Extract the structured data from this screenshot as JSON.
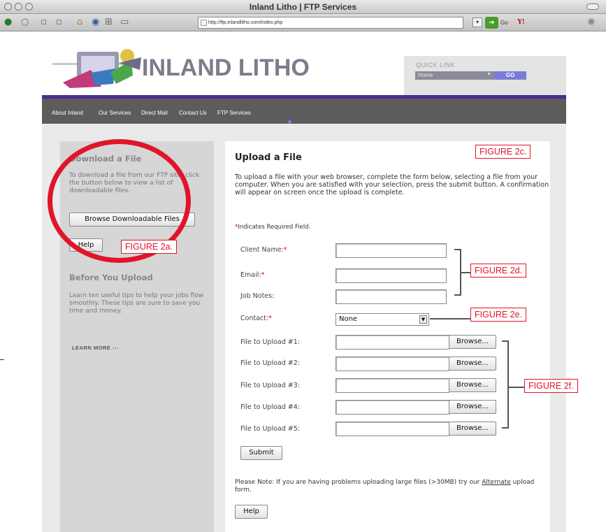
{
  "window": {
    "title": "Inland Litho | FTP Services"
  },
  "browser": {
    "url": "http://ftp.inlandlitho.com/index.php",
    "go_label": "Go",
    "yahoo_label": "Y!"
  },
  "site": {
    "logo_text": "INLAND LITHO",
    "quick_link": {
      "label": "QUICK LINK",
      "selected": "Home",
      "go": "GO"
    },
    "nav": [
      "About Inland",
      "Our Services",
      "Direct Mail",
      "Contact Us",
      "FTP Services"
    ]
  },
  "sidebar": {
    "download": {
      "heading": "Download a File",
      "text": "To download a file from our FTP site, click the button below to view a list of downloadable files.",
      "button": "Browse Downloadable Files",
      "help": "Help"
    },
    "before": {
      "heading": "Before You Upload",
      "text": "Learn ten useful tips to help your jobs flow smoothly. These tips are sure to save you time and money.",
      "learn_more": "LEARN MORE",
      "arrows": "›››"
    }
  },
  "main": {
    "heading": "Upload a File",
    "intro": "To upload a file with your web browser, complete the form below, selecting a file from your computer. When you are satisfied with your selection, press the submit button. A confirmation will appear on screen once the upload is complete.",
    "required_note": "Indicates Required Field.",
    "required_star": "*",
    "fields": {
      "client_name": "Client Name:",
      "email": "Email:",
      "job_notes": "Job Notes:",
      "contact": "Contact:"
    },
    "contact_selected": "None",
    "uploads": [
      "File to Upload #1:",
      "File to Upload #2:",
      "File to Upload #3:",
      "File to Upload #4:",
      "File to Upload #5:"
    ],
    "browse": "Browse...",
    "submit": "Submit",
    "note_prefix": "Please Note: If you are having problems uploading large files (>30MB) try our ",
    "note_link": "Alternate",
    "note_suffix": " upload form.",
    "help": "Help"
  },
  "annotations": {
    "fig_2a": "FIGURE 2a.",
    "fig_2c": "FIGURE 2c.",
    "fig_2d": "FIGURE 2d.",
    "fig_2e": "FIGURE 2e.",
    "fig_2f": "FIGURE 2f."
  },
  "colors": {
    "annotation_red": "#e0152a",
    "nav_purple": "#4a2b94",
    "nav_gray": "#5c5c5c",
    "accent_blue": "#7b7cd8"
  }
}
